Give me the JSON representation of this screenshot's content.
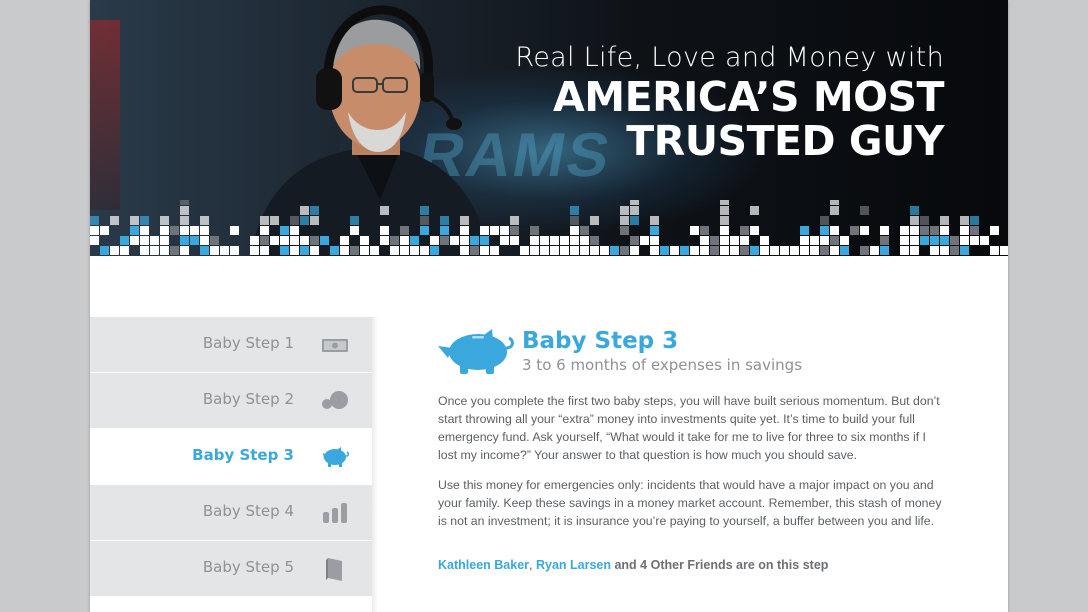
{
  "hero": {
    "subtitle": "Real Life, Love and Money with",
    "title_line1": "AMERICA’S MOST",
    "title_line2": "TRUSTED GUY",
    "background_mark": "RAMS"
  },
  "sidebar": {
    "items": [
      {
        "label": "Baby Step 1",
        "icon": "dollar-bill-icon",
        "active": false
      },
      {
        "label": "Baby Step 2",
        "icon": "snowball-icon",
        "active": false
      },
      {
        "label": "Baby Step 3",
        "icon": "piggy-bank-icon",
        "active": true
      },
      {
        "label": "Baby Step 4",
        "icon": "bar-chart-icon",
        "active": false
      },
      {
        "label": "Baby Step 5",
        "icon": "book-icon",
        "active": false
      }
    ]
  },
  "content": {
    "icon": "piggy-bank-icon",
    "title": "Baby Step 3",
    "subtitle": "3 to 6 months of expenses in savings",
    "paragraph1": "Once you complete the first two baby steps, you will have built serious momentum. But don’t start throwing all your “extra” money into investments quite yet. It’s time to build your full emergency fund. Ask yourself, “What would it take for me to live for three to six months if I lost my income?” Your answer to that question is how much you should save.",
    "paragraph2": "Use this money for emergencies only: incidents that would have a major impact on you and your family. Keep these savings in a money market account. Remember, this stash of money is not an investment; it is insurance you’re paying to yourself, a buffer between you and life.",
    "friends": {
      "friend1": "Kathleen Baker",
      "separator": ", ",
      "friend2": "Ryan Larsen",
      "rest": " and 4 Other Friends are on this step"
    }
  },
  "colors": {
    "accent": "#3aa7dd",
    "sidebar_bg": "#e4e5e7",
    "text_gray": "#5b5f63",
    "label_gray": "#8d9296"
  }
}
